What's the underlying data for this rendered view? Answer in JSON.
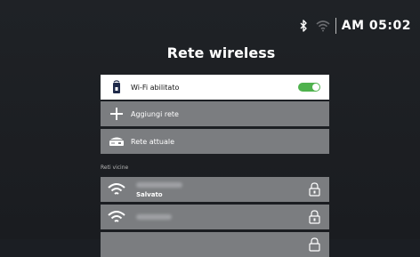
{
  "status": {
    "bluetooth_icon": "bluetooth-icon",
    "wifi_icon": "wifi-icon",
    "time": "AM 05:02"
  },
  "title": "Rete wireless",
  "settings": [
    {
      "label": "Wi-Fi abilitato",
      "icon": "router-icon",
      "enabled": true
    },
    {
      "label": "Aggiungi rete",
      "icon": "plus-icon"
    },
    {
      "label": "Rete attuale",
      "icon": "router-device-icon"
    }
  ],
  "section_label": "Reti vicine",
  "networks": [
    {
      "status": "Salvato",
      "secured": true
    },
    {
      "status": "",
      "secured": true
    },
    {
      "status": "",
      "secured": true
    }
  ],
  "colors": {
    "background": "#1b1e23",
    "row_gray": "#7b7d80",
    "toggle_on": "#4fb24d"
  }
}
